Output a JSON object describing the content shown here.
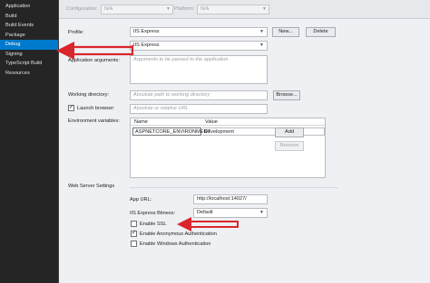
{
  "sidebar": {
    "items": [
      {
        "label": "Application"
      },
      {
        "label": "Build"
      },
      {
        "label": "Build Events"
      },
      {
        "label": "Package"
      },
      {
        "label": "Debug"
      },
      {
        "label": "Signing"
      },
      {
        "label": "TypeScript Build"
      },
      {
        "label": "Resources"
      }
    ],
    "active_index": 4
  },
  "topbar": {
    "configuration_label": "Configuration:",
    "configuration_value": "N/A",
    "platform_label": "Platform:",
    "platform_value": "N/A"
  },
  "profile": {
    "label": "Profile:",
    "value": "IIS Express",
    "new_button": "New...",
    "delete_button": "Delete"
  },
  "launch": {
    "value": "IIS Express"
  },
  "app_args": {
    "label": "Application arguments:",
    "placeholder": "Arguments to be passed to the application"
  },
  "working_dir": {
    "label": "Working directory:",
    "placeholder": "Absolute path to working directory",
    "browse_button": "Browse..."
  },
  "launch_browser": {
    "label": "Launch browser:",
    "checked": true,
    "placeholder": "Absolute or relative URL"
  },
  "env_vars": {
    "label": "Environment variables:",
    "columns": [
      "Name",
      "Value"
    ],
    "rows": [
      {
        "name": "ASPNETCORE_ENVIRONMENT",
        "value": "Development"
      }
    ],
    "add_button": "Add",
    "remove_button": "Remove"
  },
  "web_server": {
    "section_label": "Web Server Settings",
    "app_url_label": "App URL:",
    "app_url_value": "http://localhost:14027/",
    "bitness_label": "IIS Express Bitness:",
    "bitness_value": "Default",
    "enable_ssl_label": "Enable SSL",
    "enable_ssl_checked": false,
    "anon_auth_label": "Enable Anonymous Authentication",
    "anon_auth_checked": true,
    "windows_auth_label": "Enable Windows Authentication",
    "windows_auth_checked": false
  },
  "colors": {
    "arrow": "#d9262c",
    "sidebar_active": "#007acc",
    "sidebar_bg": "#252526"
  }
}
